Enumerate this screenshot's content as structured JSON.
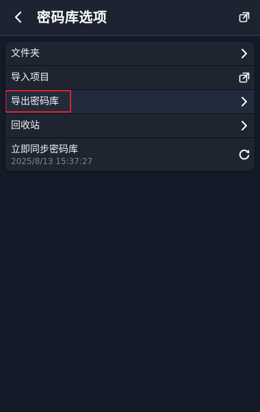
{
  "header": {
    "title": "密码库选项",
    "back_icon": "chevron-left-icon",
    "action_icon": "external-link-icon"
  },
  "menu": {
    "items": [
      {
        "label": "文件夹",
        "icon": "chevron-right-icon"
      },
      {
        "label": "导入项目",
        "icon": "external-link-icon"
      },
      {
        "label": "导出密码库",
        "icon": "chevron-right-icon",
        "highlighted": true
      },
      {
        "label": "回收站",
        "icon": "chevron-right-icon"
      },
      {
        "label": "立即同步密码库",
        "sublabel": "2025/8/13 15:37:27",
        "icon": "refresh-icon"
      }
    ]
  },
  "colors": {
    "background": "#141a27",
    "header_bg": "#1d2330",
    "card_bg": "#1e2430",
    "highlight_bg": "#222b3c",
    "focus_outline": "#d9262c",
    "subtext": "#7d8596"
  }
}
